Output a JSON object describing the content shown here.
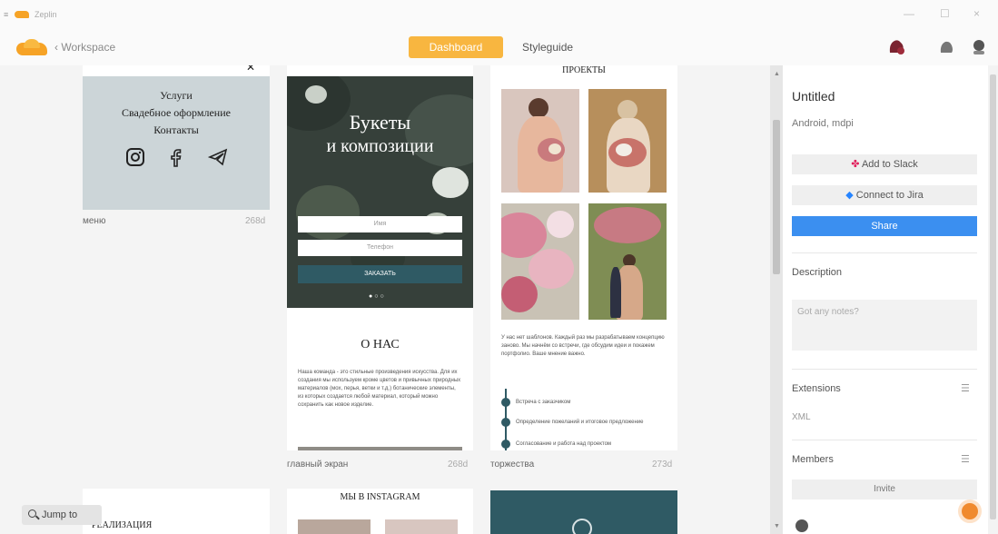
{
  "window": {
    "title": "Zeplin",
    "controls": [
      "—",
      "☐",
      "×"
    ]
  },
  "topbar": {
    "back_label": "Workspace",
    "tabs": [
      {
        "label": "Dashboard",
        "active": true
      },
      {
        "label": "Styleguide",
        "active": false
      }
    ]
  },
  "screens": [
    {
      "name": "меню",
      "time": "268d",
      "content": {
        "items": [
          "Услуги",
          "Свадебное оформление",
          "Контакты"
        ],
        "icons": [
          "instagram-icon",
          "facebook-icon",
          "telegram-icon"
        ]
      }
    },
    {
      "name": "главный экран",
      "time": "268d",
      "content": {
        "hero_line1": "Букеты",
        "hero_line2": "и композиции",
        "name_placeholder": "Имя",
        "phone_placeholder": "Телефон",
        "order_button": "ЗАКАЗАТЬ",
        "about_title": "О НАС",
        "about_text": "Наша команда - это стильные произведения искусства. Для их создания мы используем кроме цветов и привычных природных материалов (мох, перья, ветки и т.д.) ботанические элементы, из которых создается любой материал, который можно сохранить как новое изделие."
      }
    },
    {
      "name": "торжества",
      "time": "273d",
      "content": {
        "title": "ПРОЕКТЫ",
        "text": "У нас нет шаблонов. Каждый раз мы разрабатываем концепцию заново. Мы начнём со встречи, где обсудим идеи и покажем портфолио. Ваше мнение важно.",
        "timeline": [
          "Встреча с заказчиком",
          "Определение пожеланий и итоговое предложение",
          "Согласование и работа над проектом"
        ]
      }
    }
  ],
  "lower_screens": [
    {
      "title": "РЕАЛИЗАЦИЯ"
    },
    {
      "title": "МЫ В INSTAGRAM"
    }
  ],
  "jump_label": "Jump to",
  "panel": {
    "title": "Untitled",
    "subtitle": "Android, mdpi",
    "slack_button": "Add to Slack",
    "jira_button": "Connect to Jira",
    "share_button": "Share",
    "description_heading": "Description",
    "notes_placeholder": "Got any notes?",
    "extensions_heading": "Extensions",
    "extension_item": "XML",
    "members_heading": "Members",
    "invite_button": "Invite"
  },
  "colors": {
    "accent": "#f8b640",
    "primary": "#3b8ff0",
    "teal": "#2f5a64",
    "card_grey": "#ccd5d8"
  }
}
